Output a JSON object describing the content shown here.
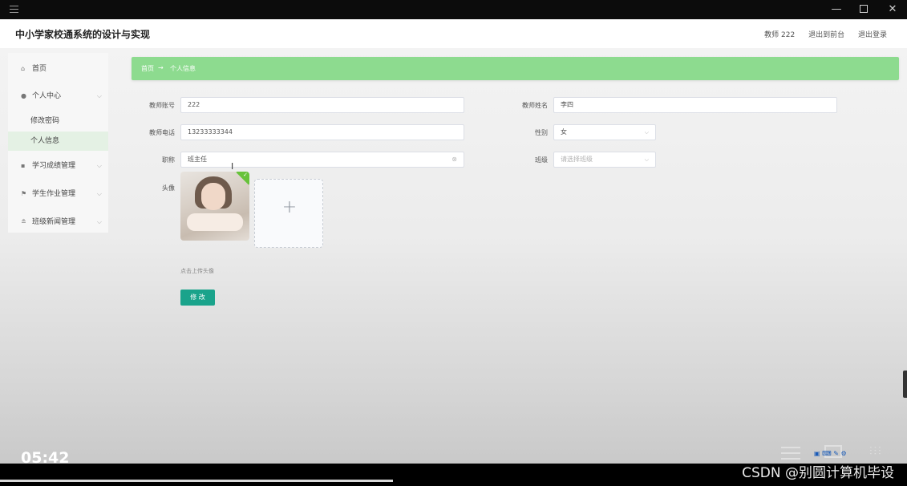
{
  "window": {
    "minimize": "—",
    "close": "✕"
  },
  "header": {
    "title": "中小学家校通系统的设计与实现",
    "user": "教师 222",
    "back_front": "退出到前台",
    "logout": "退出登录"
  },
  "sidebar": {
    "items": [
      {
        "icon": "home-icon",
        "label": "首页"
      },
      {
        "icon": "user-icon",
        "label": "个人中心"
      },
      {
        "icon": "grid-icon",
        "label": "学习成绩管理"
      },
      {
        "icon": "flag-icon",
        "label": "学生作业管理"
      },
      {
        "icon": "news-icon",
        "label": "班级新闻管理"
      }
    ],
    "sub_items": [
      {
        "label": "修改密码",
        "active": false
      },
      {
        "label": "个人信息",
        "active": true
      }
    ]
  },
  "breadcrumb": {
    "home": "首页",
    "arrow": "→",
    "current": "个人信息"
  },
  "form": {
    "account_label": "教师账号",
    "account_value": "222",
    "name_label": "教师姓名",
    "name_value": "李四",
    "phone_label": "教师电话",
    "phone_value": "13233333344",
    "gender_label": "性别",
    "gender_value": "女",
    "title_label": "职称",
    "title_value": "班主任",
    "class_label": "班级",
    "class_placeholder": "请选择班级",
    "avatar_label": "头像",
    "upload_tip": "点击上传头像",
    "submit_label": "修 改"
  },
  "video": {
    "time": "05:42",
    "watermark": "CSDN @别圆计算机毕设",
    "progress": 0.433
  },
  "colors": {
    "breadcrumb_bg": "#8ddb8f",
    "primary_button": "#1aa38b",
    "active_menu_bg": "#e4f1e4"
  }
}
